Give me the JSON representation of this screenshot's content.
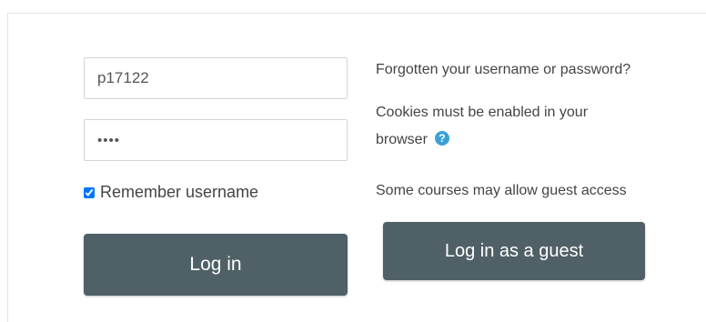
{
  "login": {
    "username_value": "p17122",
    "password_value": "••••",
    "remember_label": "Remember username",
    "remember_checked": true,
    "login_button": "Log in"
  },
  "side": {
    "forgot_link": "Forgotten your username or password?",
    "cookies_text_line1": "Cookies must be enabled in your",
    "cookies_text_line2": "browser",
    "help_icon": "question-circle-icon",
    "help_glyph": "?",
    "guest_note": "Some courses may allow guest access",
    "guest_button": "Log in as a guest"
  },
  "colors": {
    "button_bg": "#4f6066",
    "help_icon": "#3aa0d5"
  }
}
